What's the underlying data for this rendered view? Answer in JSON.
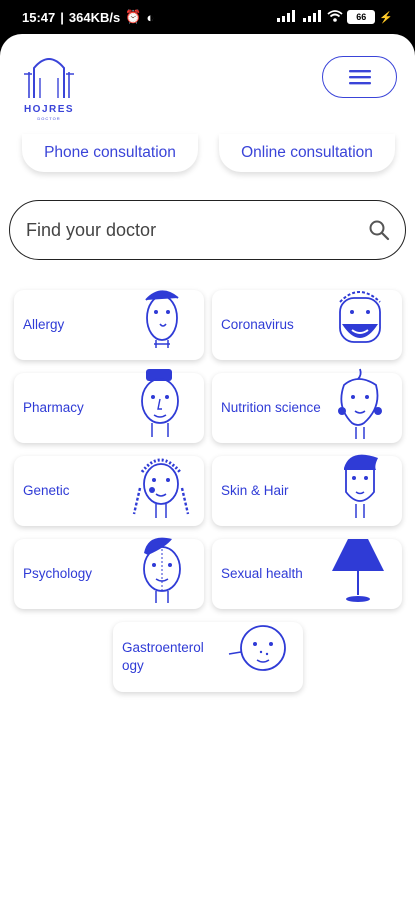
{
  "status": {
    "time": "15:47",
    "speed": "364KB/s",
    "battery": "66"
  },
  "brand": {
    "name": "HOJRES",
    "tagline": "DOCTOR"
  },
  "consult": {
    "phone": "Phone consultation",
    "online": "Online consultation"
  },
  "search": {
    "placeholder": "Find your doctor"
  },
  "categories": [
    {
      "label": "Allergy",
      "icon": "allergy-face-icon"
    },
    {
      "label": "Coronavirus",
      "icon": "coronavirus-face-icon"
    },
    {
      "label": "Pharmacy",
      "icon": "pharmacy-face-icon"
    },
    {
      "label": "Nutrition science",
      "icon": "nutrition-face-icon"
    },
    {
      "label": "Genetic",
      "icon": "genetic-face-icon"
    },
    {
      "label": "Skin & Hair",
      "icon": "skin-hair-face-icon"
    },
    {
      "label": "Psychology",
      "icon": "psychology-face-icon"
    },
    {
      "label": "Sexual health",
      "icon": "lamp-icon"
    },
    {
      "label": "Gastroenterology",
      "icon": "gastro-face-icon"
    }
  ],
  "colors": {
    "accent": "#3a44d8",
    "label": "#2f3bd6"
  }
}
